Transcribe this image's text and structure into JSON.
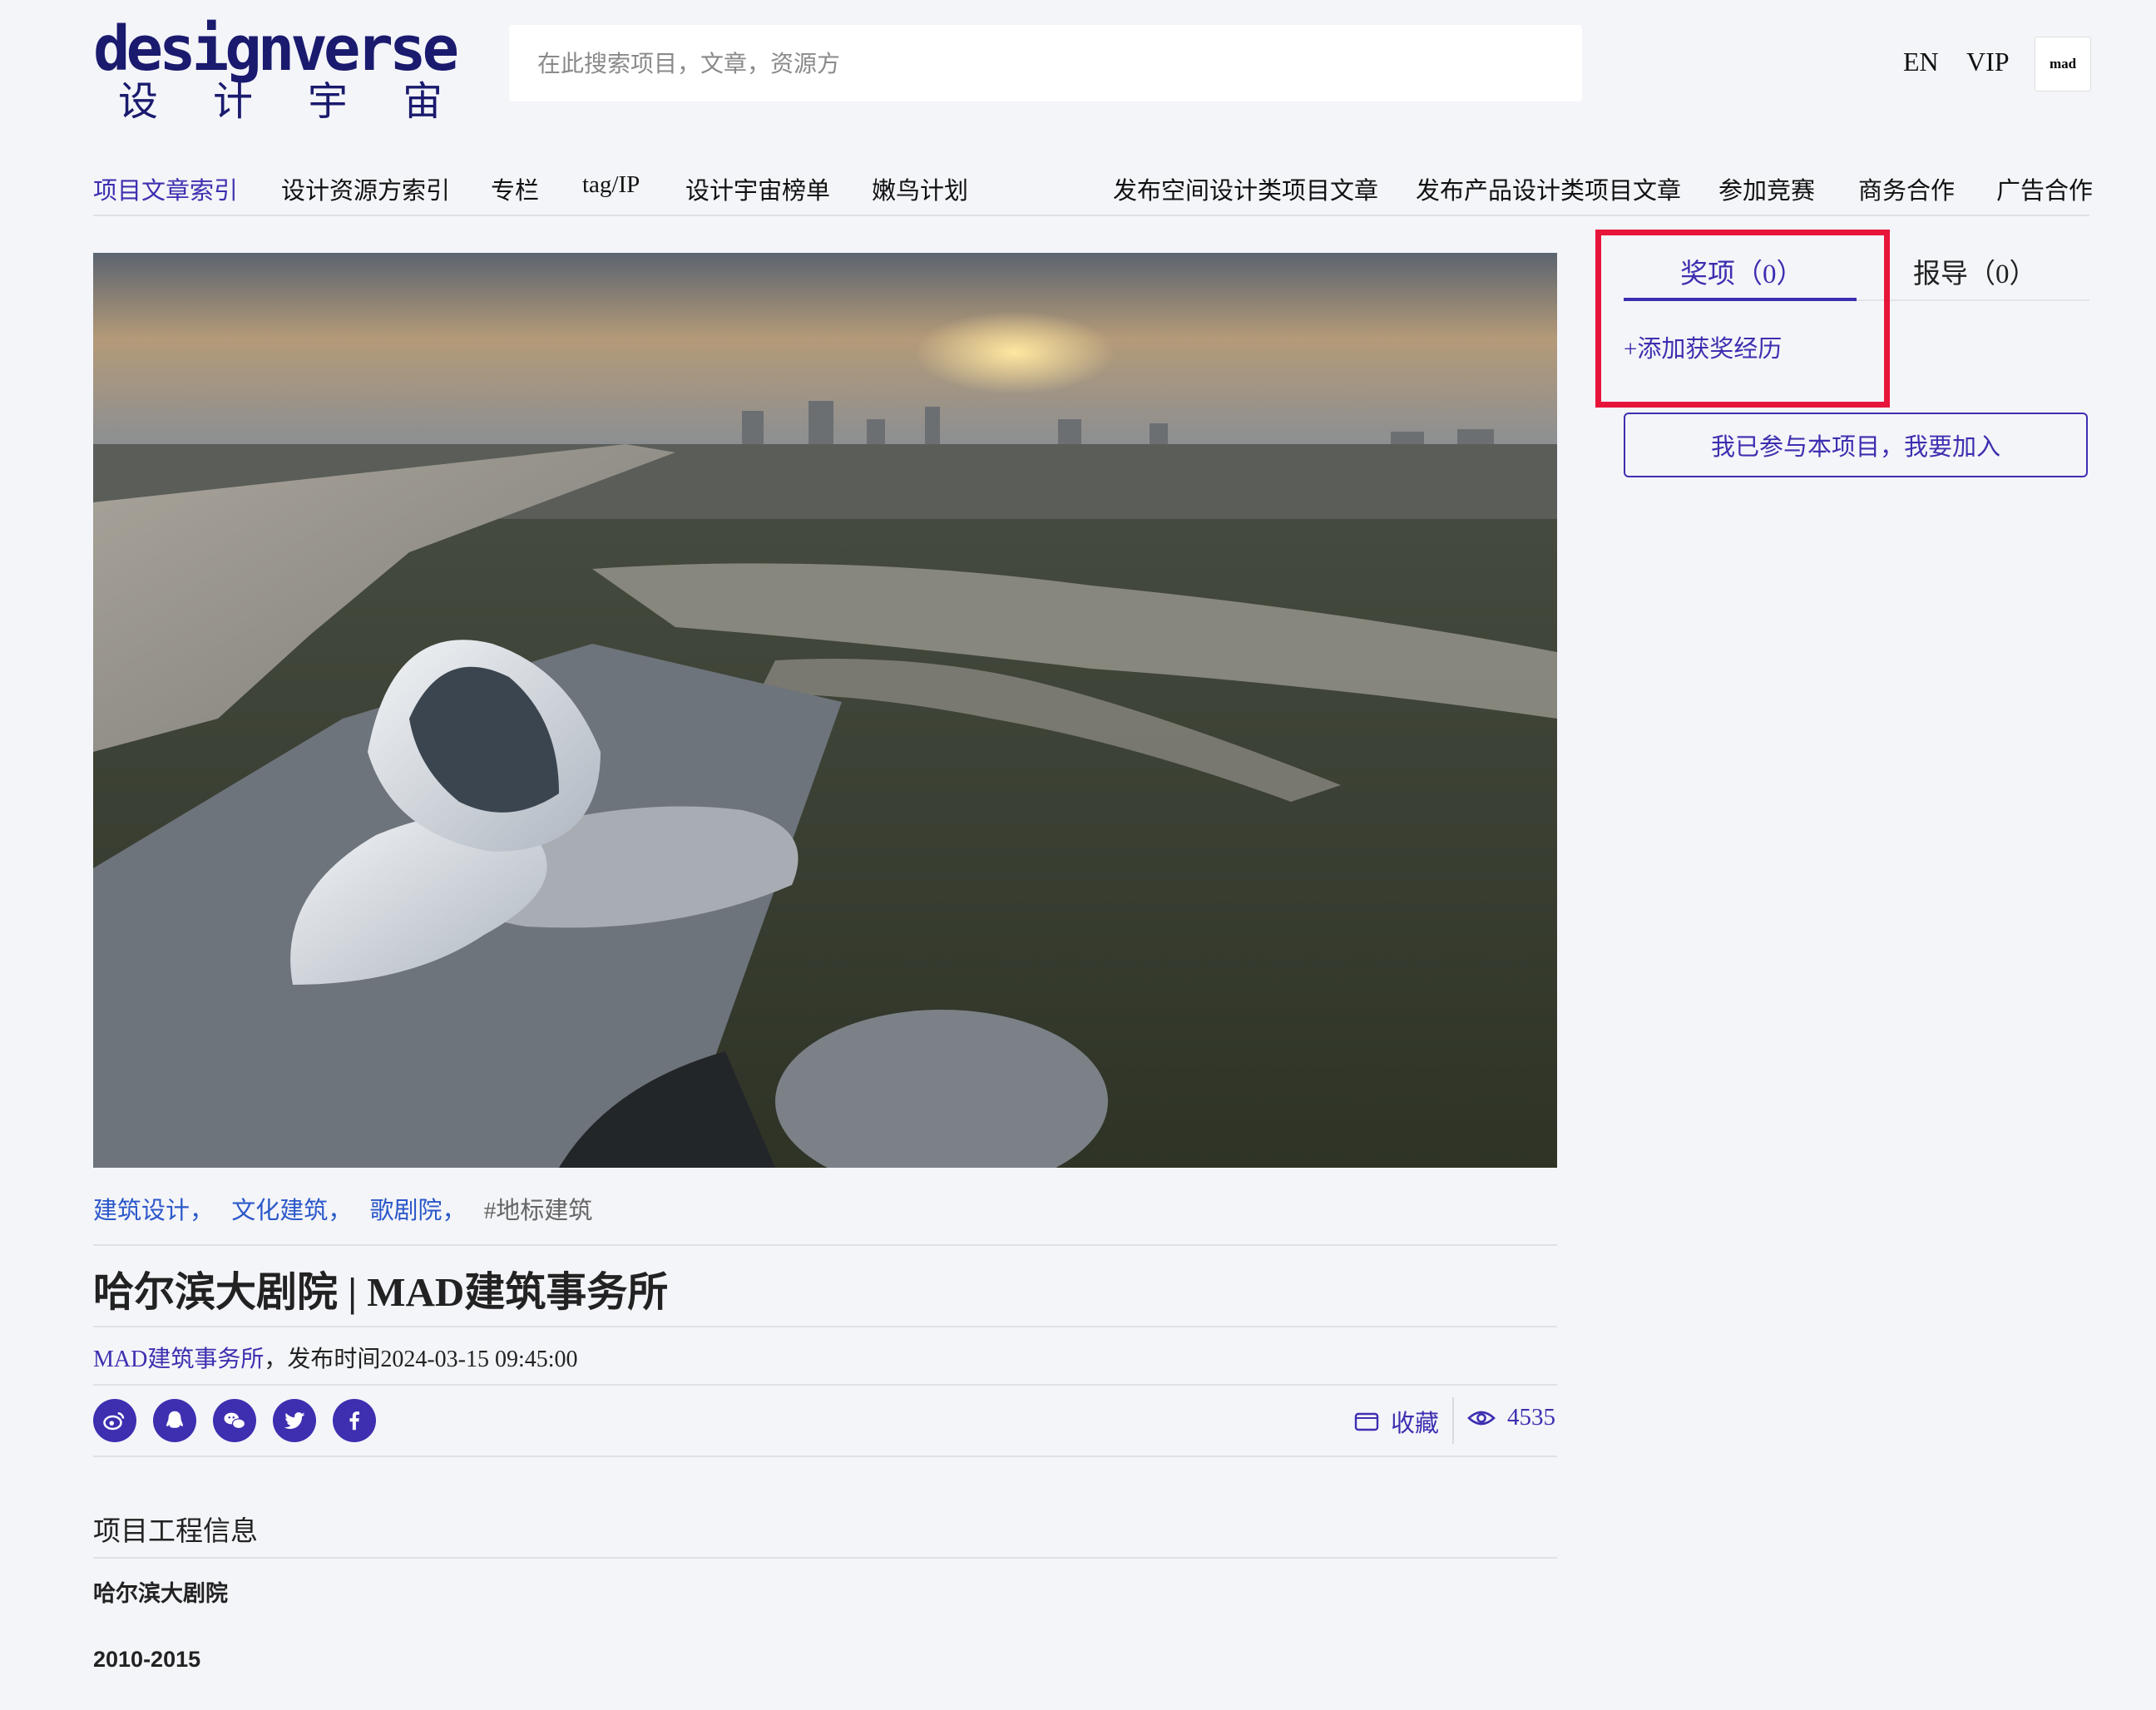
{
  "header": {
    "logo_text": "designverse",
    "logo_cn": [
      "设",
      "计",
      "宇",
      "宙"
    ],
    "search_placeholder": "在此搜索项目，文章，资源方",
    "lang_label": "EN",
    "vip_label": "VIP",
    "avatar_text": "mad"
  },
  "nav": {
    "left": [
      "项目文章索引",
      "设计资源方索引",
      "专栏",
      "tag/IP",
      "设计宇宙榜单",
      "嫩鸟计划"
    ],
    "right": [
      "发布空间设计类项目文章",
      "发布产品设计类项目文章",
      "参加竞赛",
      "商务合作",
      "广告合作"
    ]
  },
  "article": {
    "tags": [
      "建筑设计，",
      "文化建筑，",
      "歌剧院，"
    ],
    "hash_tag": "#地标建筑",
    "title": "哈尔滨大剧院 | MAD建筑事务所",
    "author": "MAD建筑事务所",
    "publish_text": "，发布时间2024-03-15 09:45:00",
    "favorite_label": "收藏",
    "view_count": "4535",
    "section_title": "项目工程信息",
    "info_lines": [
      "哈尔滨大剧院",
      "2010-2015"
    ]
  },
  "share_icons": [
    "weibo-icon",
    "qq-icon",
    "wechat-icon",
    "twitter-icon",
    "facebook-icon"
  ],
  "sidebar": {
    "tab_awards": "奖项（0）",
    "tab_reports": "报导（0）",
    "add_award": "+添加获奖经历",
    "join_button": "我已参与本项目，我要加入"
  },
  "colors": {
    "accent": "#3d2fb0",
    "tag_blue": "#2b58c9",
    "highlight_red": "#e8153b",
    "background": "#f4f5f9"
  }
}
